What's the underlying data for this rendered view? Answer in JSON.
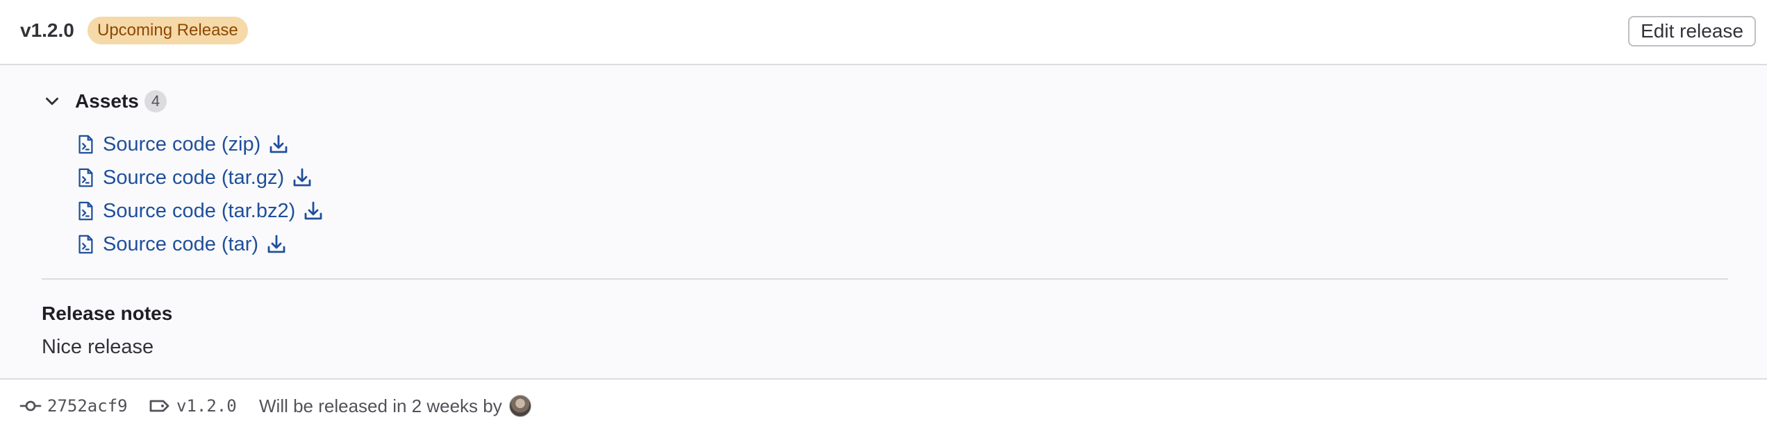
{
  "header": {
    "tag_name": "v1.2.0",
    "badge": "Upcoming Release",
    "edit_button": "Edit release"
  },
  "assets": {
    "title": "Assets",
    "count": "4",
    "items": [
      {
        "label": "Source code (zip)",
        "icon": "file-code-icon",
        "action_icon": "download-icon"
      },
      {
        "label": "Source code (tar.gz)",
        "icon": "file-code-icon",
        "action_icon": "download-icon"
      },
      {
        "label": "Source code (tar.bz2)",
        "icon": "file-code-icon",
        "action_icon": "download-icon"
      },
      {
        "label": "Source code (tar)",
        "icon": "file-code-icon",
        "action_icon": "download-icon"
      }
    ]
  },
  "release_notes": {
    "heading": "Release notes",
    "body": "Nice release"
  },
  "footer": {
    "commit_sha": "2752acf9",
    "tag": "v1.2.0",
    "release_text": "Will be released in 2 weeks by"
  },
  "colors": {
    "link": "#1f4f9a",
    "badge_bg": "#f5d9a8",
    "badge_text": "#8f4700",
    "body_bg": "#fafafc"
  }
}
